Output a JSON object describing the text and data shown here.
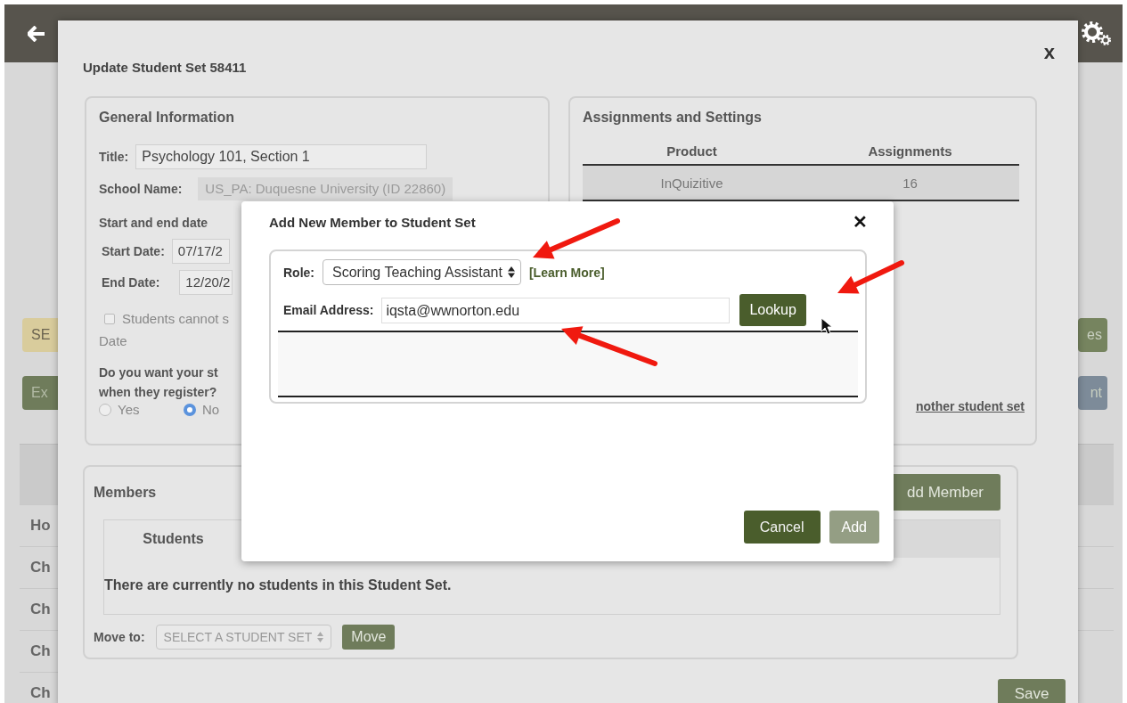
{
  "background_page": {
    "left_buttons": [
      {
        "label": "SE",
        "color": "#d9cc9c"
      },
      {
        "label": "Ex",
        "color": "#6f7c5b"
      }
    ],
    "right_buttons": [
      {
        "label": "es",
        "color": "#76845f"
      },
      {
        "label": "nt",
        "color": "#7d8b99"
      }
    ],
    "left_table_rows": [
      "Ho",
      "Ch",
      "Ch",
      "Ch",
      "Ch"
    ]
  },
  "update_dialog": {
    "title": "Update Student Set 58411",
    "close": "x",
    "general_information": {
      "heading": "General Information",
      "title_label": "Title:",
      "title_value": "Psychology 101, Section 1",
      "school_label": "School Name:",
      "school_value": "US_PA: Duquesne University (ID 22860)",
      "dates_heading": "Start and end date",
      "start_label": "Start Date:",
      "start_value": "07/17/2",
      "end_label": "End Date:",
      "end_value": "12/20/2",
      "checkbox": {
        "label": "Students cannot s",
        "checked": false
      },
      "checkbox_line_2": "Date",
      "question": [
        "Do you want your st",
        "when they register?"
      ],
      "radios": [
        {
          "label": "Yes",
          "selected": false
        },
        {
          "label": "No",
          "selected": true
        }
      ]
    },
    "assignments": {
      "heading": "Assignments and Settings",
      "columns": [
        "Product",
        "Assignments"
      ],
      "rows": [
        [
          "InQuizitive",
          "16"
        ]
      ],
      "link": "nother student set"
    },
    "members": {
      "heading": "Members",
      "add_button": "dd Member",
      "tabs": [
        {
          "label": "Students",
          "selected": true
        }
      ],
      "empty_message": "There are currently no students in this Student Set.",
      "move_label": "Move to:",
      "move_select": "SELECT A STUDENT SET",
      "move_button": "Move"
    },
    "save_button": "Save"
  },
  "add_member_dialog": {
    "title": "Add New Member to Student Set",
    "close": "✕",
    "role_label": "Role:",
    "role_value": "Scoring Teaching Assistant",
    "learn_more": "[Learn More]",
    "email_label": "Email Address:",
    "email_value": "iqsta@wwnorton.edu",
    "lookup_button": "Lookup",
    "buttons": [
      {
        "label": "Cancel",
        "disabled": false
      },
      {
        "label": "Add",
        "disabled": true
      }
    ]
  }
}
